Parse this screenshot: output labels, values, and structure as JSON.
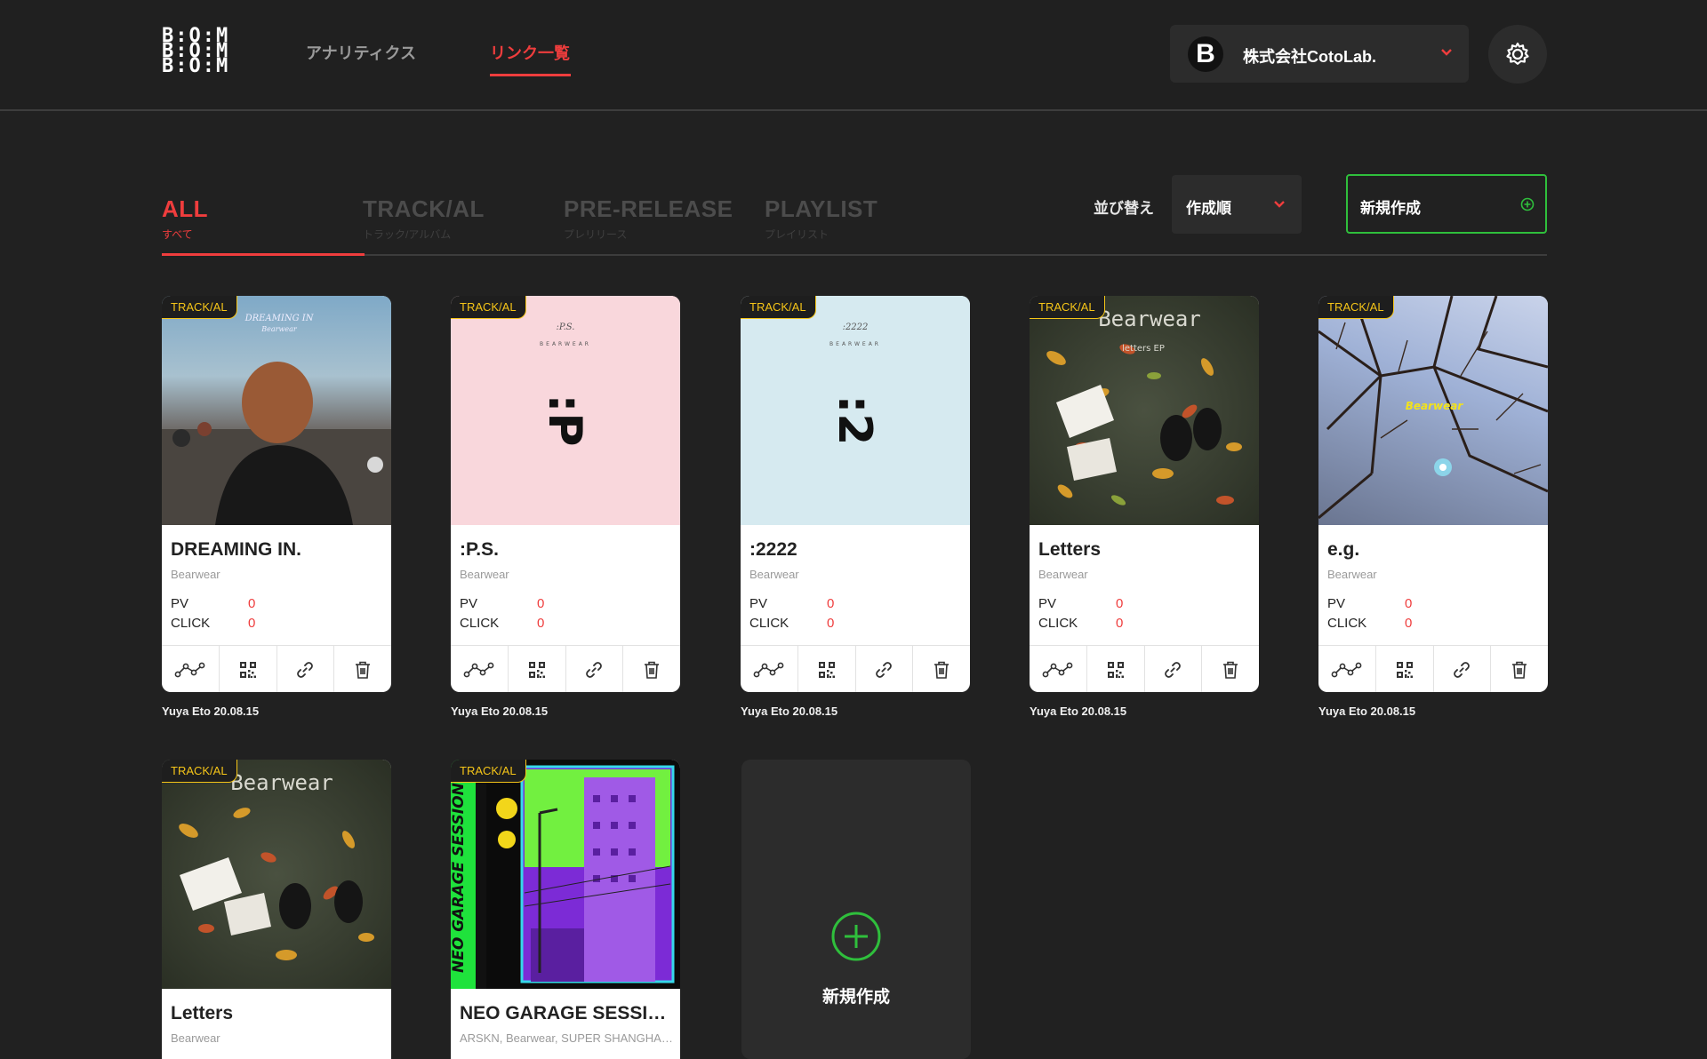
{
  "header": {
    "logo": "B:O:M",
    "nav": [
      {
        "label": "アナリティクス"
      },
      {
        "label": "リンク一覧"
      }
    ],
    "org": {
      "initial": "B",
      "name": "株式会社CotoLab."
    }
  },
  "tabs": [
    {
      "label": "ALL",
      "sub": "すべて"
    },
    {
      "label": "TRACK/AL",
      "sub": "トラック/アルバム"
    },
    {
      "label": "PRE-RELEASE",
      "sub": "プレリリース"
    },
    {
      "label": "PLAYLIST",
      "sub": "プレイリスト"
    }
  ],
  "sort": {
    "label": "並び替え",
    "value": "作成順"
  },
  "new_button": {
    "label": "新規作成"
  },
  "stats_labels": {
    "pv": "PV",
    "click": "CLICK"
  },
  "cards": [
    {
      "badge": "TRACK/AL",
      "title": "DREAMING IN.",
      "artist": "Bearwear",
      "pv": "0",
      "click": "0",
      "meta": "Yuya Eto 20.08.15",
      "art_text": "DREAMING IN",
      "art_sub": "Bearwear"
    },
    {
      "badge": "TRACK/AL",
      "title": ":P.S.",
      "artist": "Bearwear",
      "pv": "0",
      "click": "0",
      "meta": "Yuya Eto 20.08.15",
      "art_text": ":P.S.",
      "art_sub": "BEARWEAR",
      "art_face": ":P"
    },
    {
      "badge": "TRACK/AL",
      "title": ":2222",
      "artist": "Bearwear",
      "pv": "0",
      "click": "0",
      "meta": "Yuya Eto 20.08.15",
      "art_text": ":2222",
      "art_sub": "BEARWEAR",
      "art_face": ":2"
    },
    {
      "badge": "TRACK/AL",
      "title": "Letters",
      "artist": "Bearwear",
      "pv": "0",
      "click": "0",
      "meta": "Yuya Eto 20.08.15",
      "art_text": "Bearwear",
      "art_sub": "letters EP"
    },
    {
      "badge": "TRACK/AL",
      "title": "e.g.",
      "artist": "Bearwear",
      "pv": "0",
      "click": "0",
      "meta": "Yuya Eto 20.08.15",
      "art_text": "Bearwear"
    },
    {
      "badge": "TRACK/AL",
      "title": "Letters",
      "artist": "Bearwear",
      "art_text": "Bearwear"
    },
    {
      "badge": "TRACK/AL",
      "title": "NEO GARAGE SESSIO...",
      "artist": "ARSKN, Bearwear, SUPER SHANGHAI...",
      "art_text": "NEO GARAGE SESSION"
    }
  ],
  "new_card": {
    "label": "新規作成"
  },
  "colors": {
    "accent": "#ef3d3d",
    "green": "#2fbf3c",
    "badge": "#f5c518",
    "background": "#212121"
  }
}
